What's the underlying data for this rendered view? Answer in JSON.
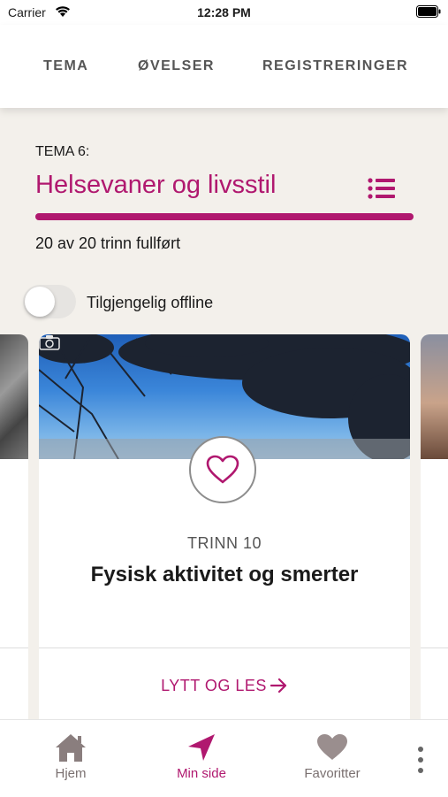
{
  "status_bar": {
    "carrier": "Carrier",
    "time": "12:28 PM"
  },
  "top_nav": {
    "tabs": [
      {
        "label": "TEMA"
      },
      {
        "label": "ØVELSER"
      },
      {
        "label": "REGISTRERINGER"
      }
    ]
  },
  "header": {
    "tema_label": "TEMA 6:",
    "title": "Helsevaner og livsstil",
    "progress_text": "20 av 20 trinn fullført",
    "progress_fraction": 1.0
  },
  "offline": {
    "label": "Tilgjengelig offline",
    "enabled": false
  },
  "card": {
    "step_label": "TRINN 10",
    "title": "Fysisk aktivitet og smerter",
    "action_label": "LYTT OG LES"
  },
  "bottom_nav": {
    "items": [
      {
        "label": "Hjem",
        "icon": "home-icon"
      },
      {
        "label": "Min side",
        "icon": "navigation-arrow-icon"
      },
      {
        "label": "Favoritter",
        "icon": "heart-icon"
      }
    ],
    "more_icon": "more-vertical-icon"
  },
  "colors": {
    "accent": "#b0186f",
    "background": "#f3f0eb",
    "inactive": "#7a7070"
  }
}
